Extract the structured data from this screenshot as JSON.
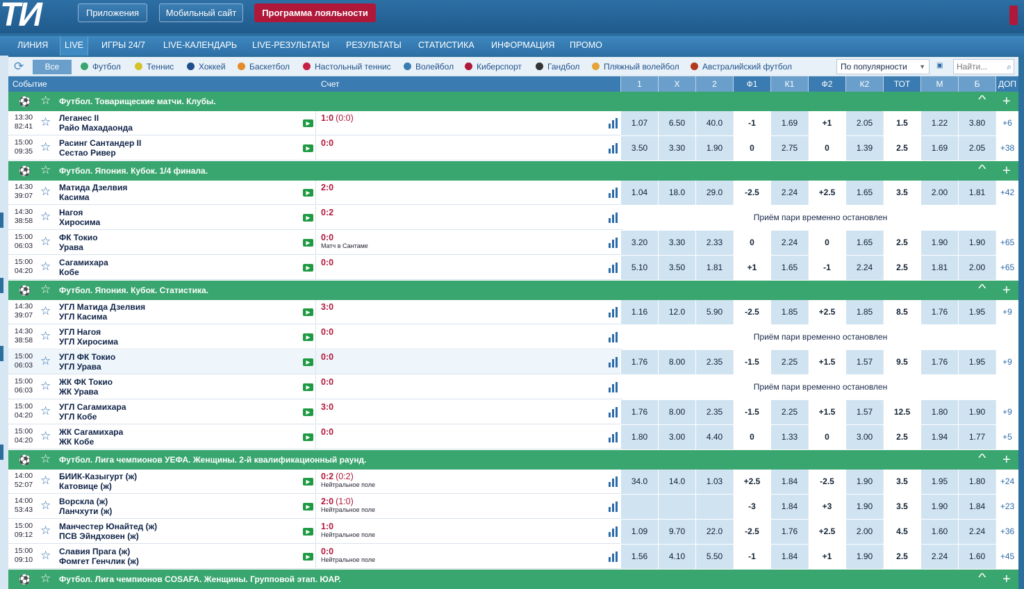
{
  "logo": "ТИ",
  "top_buttons": [
    "Приложения",
    "Мобильный сайт",
    "Программа лояльности"
  ],
  "nav": [
    "ЛИНИЯ",
    "LIVE",
    "ИГРЫ 24/7",
    "LIVE-КАЛЕНДАРЬ",
    "LIVE-РЕЗУЛЬТАТЫ",
    "РЕЗУЛЬТАТЫ",
    "СТАТИСТИКА",
    "ИНФОРМАЦИЯ",
    "ПРОМО"
  ],
  "filter": {
    "all": "Все",
    "sports": [
      "Футбол",
      "Теннис",
      "Хоккей",
      "Баскетбол",
      "Настольный теннис",
      "Волейбол",
      "Киберспорт",
      "Гандбол",
      "Пляжный волейбол",
      "Австралийский футбол"
    ],
    "sort": "По популярности",
    "search_placeholder": "Найти..."
  },
  "header": {
    "event": "Событие",
    "score": "Счет",
    "cols": [
      "1",
      "X",
      "2",
      "Ф1",
      "К1",
      "Ф2",
      "К2",
      "ТОТ",
      "М",
      "Б",
      "ДОП"
    ]
  },
  "suspended_text": "Приём пари временно остановлен",
  "leagues": [
    {
      "name": "Футбол. Товарищеские матчи. Клубы.",
      "events": [
        {
          "start": "13:30",
          "clock": "82:41",
          "team1": "Леганес II",
          "team2": "Райо Махадаонда",
          "score": "1:0",
          "period": "(0:0)",
          "note": "",
          "odds": [
            "1.07",
            "6.50",
            "40.0",
            "-1",
            "1.69",
            "+1",
            "2.05",
            "1.5",
            "1.22",
            "3.80",
            "+6"
          ]
        },
        {
          "start": "15:00",
          "clock": "09:35",
          "team1": "Расинг Сантандер II",
          "team2": "Сестао Ривер",
          "score": "0:0",
          "period": "",
          "note": "",
          "odds": [
            "3.50",
            "3.30",
            "1.90",
            "0",
            "2.75",
            "0",
            "1.39",
            "2.5",
            "1.69",
            "2.05",
            "+38"
          ]
        }
      ]
    },
    {
      "name": "Футбол. Япония. Кубок. 1/4 финала.",
      "events": [
        {
          "start": "14:30",
          "clock": "39:07",
          "team1": "Матида Дзелвия",
          "team2": "Касима",
          "score": "2:0",
          "period": "",
          "note": "",
          "odds": [
            "1.04",
            "18.0",
            "29.0",
            "-2.5",
            "2.24",
            "+2.5",
            "1.65",
            "3.5",
            "2.00",
            "1.81",
            "+42"
          ]
        },
        {
          "start": "14:30",
          "clock": "38:58",
          "team1": "Нагоя",
          "team2": "Хиросима",
          "score": "0:2",
          "period": "",
          "note": "",
          "suspended": true
        },
        {
          "start": "15:00",
          "clock": "06:03",
          "team1": "ФК Токио",
          "team2": "Урава",
          "score": "0:0",
          "period": "",
          "note": "Матч в Сантаме",
          "odds": [
            "3.20",
            "3.30",
            "2.33",
            "0",
            "2.24",
            "0",
            "1.65",
            "2.5",
            "1.90",
            "1.90",
            "+65"
          ]
        },
        {
          "start": "15:00",
          "clock": "04:20",
          "team1": "Сагамихара",
          "team2": "Кобе",
          "score": "0:0",
          "period": "",
          "note": "",
          "odds": [
            "5.10",
            "3.50",
            "1.81",
            "+1",
            "1.65",
            "-1",
            "2.24",
            "2.5",
            "1.81",
            "2.00",
            "+65"
          ]
        }
      ]
    },
    {
      "name": "Футбол. Япония. Кубок. Статистика.",
      "events": [
        {
          "start": "14:30",
          "clock": "39:07",
          "team1": "УГЛ Матида Дзелвия",
          "team2": "УГЛ Касима",
          "score": "3:0",
          "period": "",
          "note": "",
          "odds": [
            "1.16",
            "12.0",
            "5.90",
            "-2.5",
            "1.85",
            "+2.5",
            "1.85",
            "8.5",
            "1.76",
            "1.95",
            "+9"
          ]
        },
        {
          "start": "14:30",
          "clock": "38:58",
          "team1": "УГЛ Нагоя",
          "team2": "УГЛ Хиросима",
          "score": "0:0",
          "period": "",
          "note": "",
          "suspended": true
        },
        {
          "start": "15:00",
          "clock": "06:03",
          "team1": "УГЛ ФК Токио",
          "team2": "УГЛ Урава",
          "score": "0:0",
          "period": "",
          "note": "",
          "highlight": true,
          "odds": [
            "1.76",
            "8.00",
            "2.35",
            "-1.5",
            "2.25",
            "+1.5",
            "1.57",
            "9.5",
            "1.76",
            "1.95",
            "+9"
          ]
        },
        {
          "start": "15:00",
          "clock": "06:03",
          "team1": "ЖК ФК Токио",
          "team2": "ЖК Урава",
          "score": "0:0",
          "period": "",
          "note": "",
          "suspended": true
        },
        {
          "start": "15:00",
          "clock": "04:20",
          "team1": "УГЛ Сагамихара",
          "team2": "УГЛ Кобе",
          "score": "3:0",
          "period": "",
          "note": "",
          "odds": [
            "1.76",
            "8.00",
            "2.35",
            "-1.5",
            "2.25",
            "+1.5",
            "1.57",
            "12.5",
            "1.80",
            "1.90",
            "+9"
          ]
        },
        {
          "start": "15:00",
          "clock": "04:20",
          "team1": "ЖК Сагамихара",
          "team2": "ЖК Кобе",
          "score": "0:0",
          "period": "",
          "note": "",
          "odds": [
            "1.80",
            "3.00",
            "4.40",
            "0",
            "1.33",
            "0",
            "3.00",
            "2.5",
            "1.94",
            "1.77",
            "+5"
          ]
        }
      ]
    },
    {
      "name": "Футбол. Лига чемпионов УЕФА. Женщины. 2-й квалификационный раунд.",
      "events": [
        {
          "start": "14:00",
          "clock": "52:07",
          "team1": "БИИК-Казыгурт (ж)",
          "team2": "Катовице (ж)",
          "score": "0:2",
          "period": "(0:2)",
          "note": "Нейтральное поле",
          "odds": [
            "34.0",
            "14.0",
            "1.03",
            "+2.5",
            "1.84",
            "-2.5",
            "1.90",
            "3.5",
            "1.95",
            "1.80",
            "+24"
          ]
        },
        {
          "start": "14:00",
          "clock": "53:43",
          "team1": "Ворскла (ж)",
          "team2": "Ланчхути (ж)",
          "score": "2:0",
          "period": "(1:0)",
          "note": "Нейтральное поле",
          "odds": [
            "",
            "",
            "",
            "-3",
            "1.84",
            "+3",
            "1.90",
            "3.5",
            "1.90",
            "1.84",
            "+23"
          ]
        },
        {
          "start": "15:00",
          "clock": "09:12",
          "team1": "Манчестер Юнайтед (ж)",
          "team2": "ПСВ Эйндховен (ж)",
          "score": "1:0",
          "period": "",
          "note": "Нейтральное поле",
          "odds": [
            "1.09",
            "9.70",
            "22.0",
            "-2.5",
            "1.76",
            "+2.5",
            "2.00",
            "4.5",
            "1.60",
            "2.24",
            "+36"
          ]
        },
        {
          "start": "15:00",
          "clock": "09:10",
          "team1": "Славия Прага (ж)",
          "team2": "Фомгет Генчлик (ж)",
          "score": "0:0",
          "period": "",
          "note": "Нейтральное поле",
          "odds": [
            "1.56",
            "4.10",
            "5.50",
            "-1",
            "1.84",
            "+1",
            "1.90",
            "2.5",
            "2.24",
            "1.60",
            "+45"
          ]
        }
      ]
    },
    {
      "name": "Футбол. Лига чемпионов COSAFA. Женщины. Групповой этап. ЮАР.",
      "events": []
    }
  ]
}
